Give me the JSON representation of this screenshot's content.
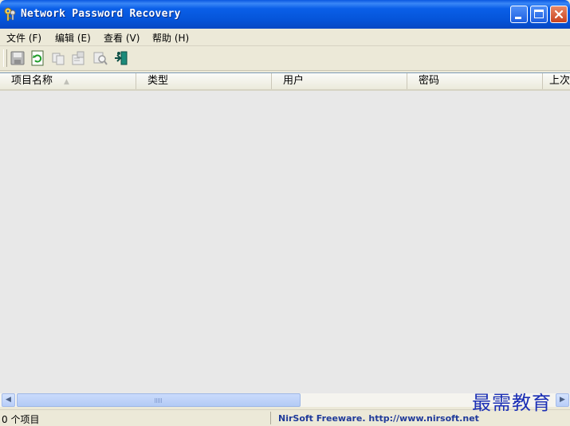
{
  "window": {
    "title": "Network Password Recovery",
    "colors": {
      "titlebar": "#0a5fe8",
      "close_button": "#d9532b",
      "window_bg": "#ece9d8"
    }
  },
  "menu": {
    "items": [
      {
        "label": "文件 (F)"
      },
      {
        "label": "编辑 (E)"
      },
      {
        "label": "查看 (V)"
      },
      {
        "label": "帮助 (H)"
      }
    ]
  },
  "toolbar": {
    "buttons": [
      {
        "icon": "save-icon"
      },
      {
        "icon": "refresh-icon"
      },
      {
        "icon": "copy-icon"
      },
      {
        "icon": "properties-icon"
      },
      {
        "icon": "find-icon"
      },
      {
        "icon": "exit-icon"
      }
    ]
  },
  "list": {
    "columns": [
      "项目名称",
      "类型",
      "用户",
      "密码",
      "上次"
    ],
    "sort_indicator": "▲",
    "rows": []
  },
  "scrollbar": {
    "left_arrow": "◀",
    "right_arrow": "▶"
  },
  "status": {
    "count": "0 个项目",
    "credit": "NirSoft Freeware.  http://www.nirsoft.net"
  },
  "watermark": "最需教育"
}
